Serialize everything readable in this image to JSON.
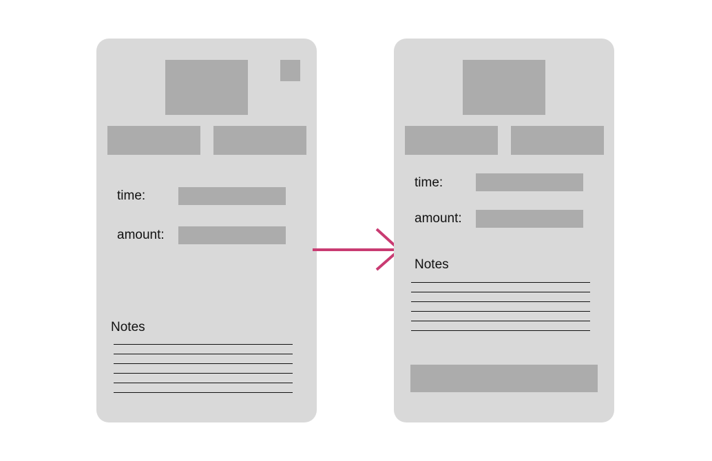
{
  "left_screen": {
    "time_label": "time:",
    "amount_label": "amount:",
    "notes_label": "Notes"
  },
  "right_screen": {
    "time_label": "time:",
    "amount_label": "amount:",
    "notes_label": "Notes"
  },
  "colors": {
    "screen_background": "#d9d9d9",
    "placeholder_block": "#acacac",
    "arrow": "#c93b72",
    "note_lines": "#111111"
  }
}
